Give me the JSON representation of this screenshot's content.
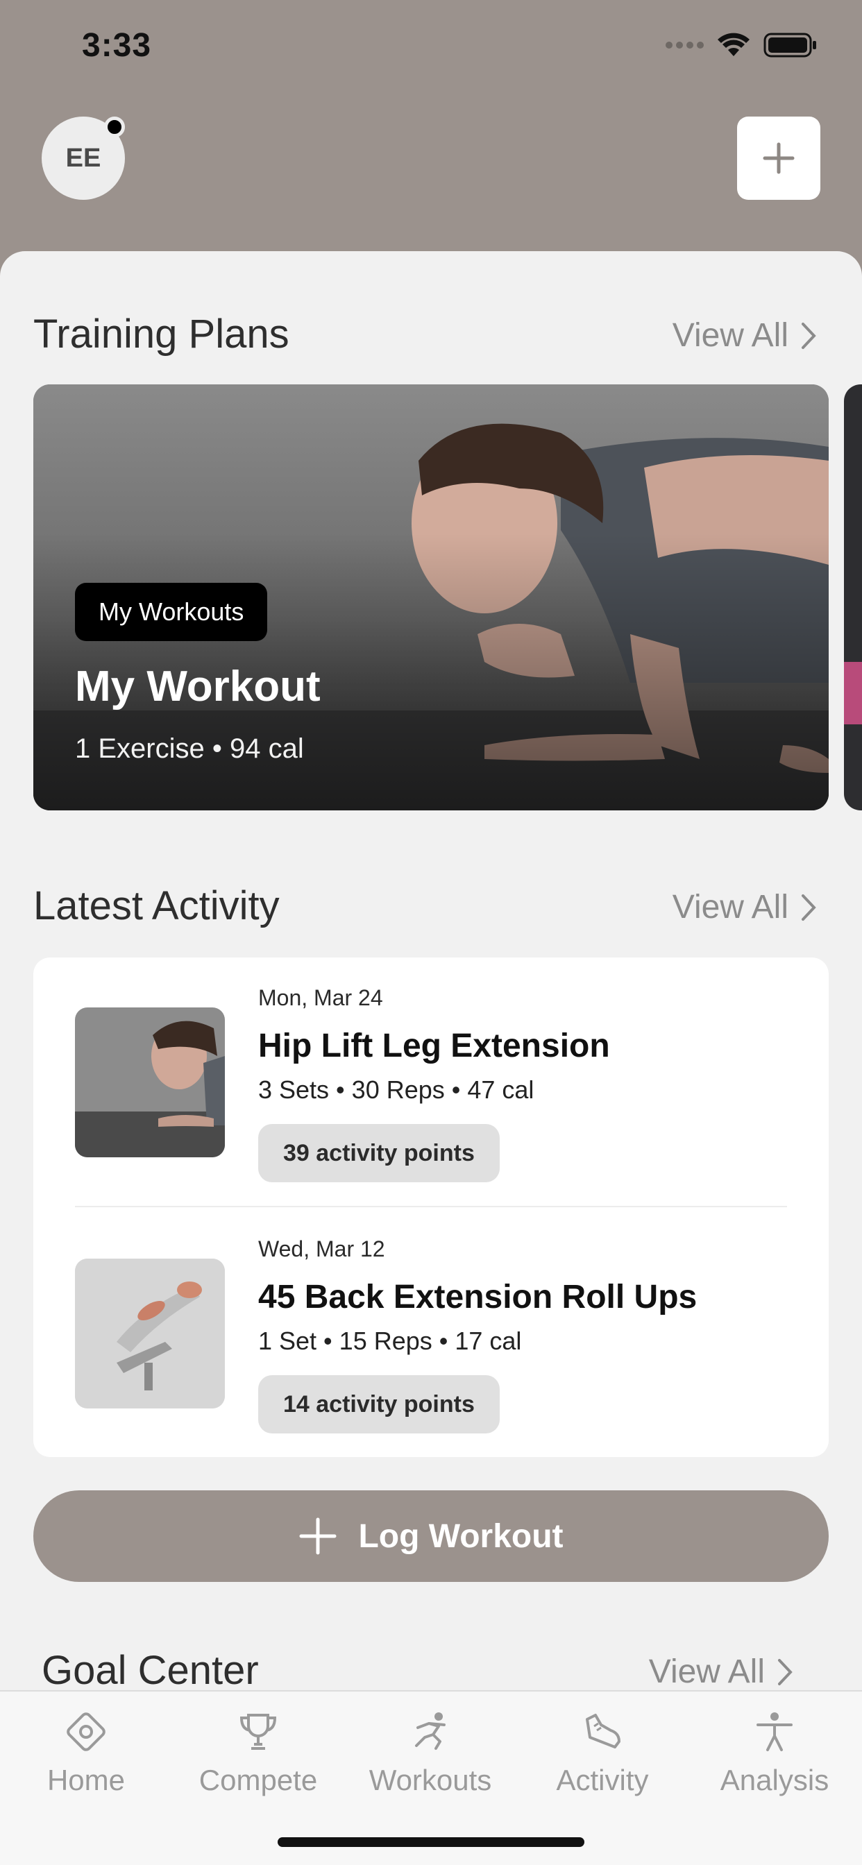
{
  "status_bar": {
    "time": "3:33"
  },
  "header": {
    "avatar_initials": "EE"
  },
  "training_plans": {
    "title": "Training Plans",
    "view_all": "View All",
    "card": {
      "badge": "My Workouts",
      "title": "My Workout",
      "subtitle": "1 Exercise • 94 cal"
    }
  },
  "latest_activity": {
    "title": "Latest Activity",
    "view_all": "View All",
    "items": [
      {
        "date": "Mon, Mar 24",
        "title": "Hip Lift Leg Extension",
        "meta": "3 Sets • 30 Reps • 47 cal",
        "points": "39 activity points"
      },
      {
        "date": "Wed, Mar 12",
        "title": "45 Back Extension Roll Ups",
        "meta": "1 Set • 15 Reps • 17 cal",
        "points": "14 activity points"
      }
    ]
  },
  "log_workout": {
    "label": "Log Workout"
  },
  "goal_center": {
    "title": "Goal Center",
    "view_all": "View All"
  },
  "tabs": [
    {
      "label": "Home",
      "icon": "diamond-icon"
    },
    {
      "label": "Compete",
      "icon": "trophy-icon"
    },
    {
      "label": "Workouts",
      "icon": "runner-icon"
    },
    {
      "label": "Activity",
      "icon": "shoe-icon"
    },
    {
      "label": "Analysis",
      "icon": "person-icon"
    }
  ],
  "colors": {
    "accent": "#9b928d",
    "background": "#f1f1f1"
  }
}
